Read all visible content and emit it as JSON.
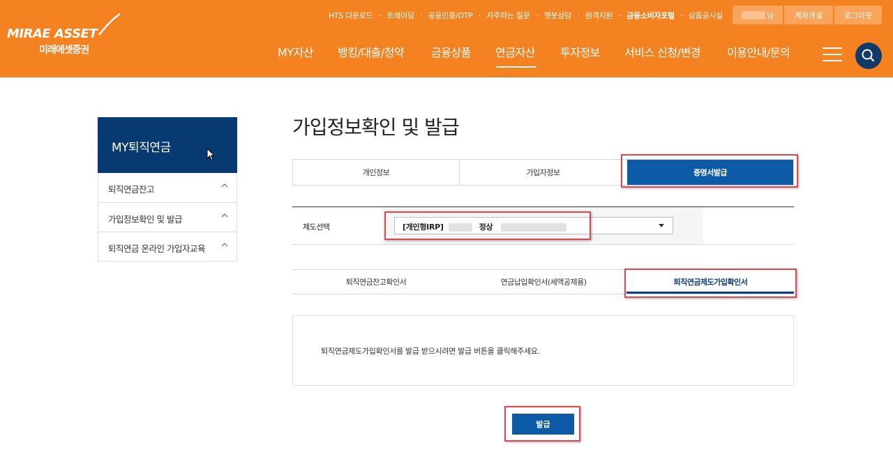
{
  "brand": {
    "name": "MIRAE ASSET",
    "name_ko": "미래에셋증권"
  },
  "utility_links": [
    "HTS 다운로드",
    "트레이딩",
    "공동인증/OTP",
    "자주하는 질문",
    "챗봇상담",
    "원격지원",
    "금융소비자포털",
    "상품공시실"
  ],
  "user": {
    "suffix": "님",
    "open_account": "계좌개설",
    "logout": "로그아웃"
  },
  "nav": {
    "items": [
      "MY자산",
      "뱅킹/대출/청약",
      "금융상품",
      "연금자산",
      "투자정보",
      "서비스 신청/변경",
      "이용안내/문의"
    ],
    "active": "연금자산"
  },
  "sidebar": {
    "title": "MY퇴직연금",
    "items": [
      {
        "label": "퇴직연금잔고"
      },
      {
        "label": "가입정보확인 및 발급"
      },
      {
        "label": "퇴직연금 온라인 가입자교육"
      }
    ]
  },
  "main": {
    "title": "가입정보확인 및 발급",
    "tabs": [
      {
        "label": "개인정보"
      },
      {
        "label": "가입자정보"
      },
      {
        "label": "증명서발급"
      }
    ],
    "select": {
      "label": "제도선택",
      "value_prefix": "[개인형IRP]",
      "value_status": "정상"
    },
    "doc_tabs": [
      {
        "label": "퇴직연금잔고확인서"
      },
      {
        "label": "연금납입확인서(세액공제용)"
      },
      {
        "label": "퇴직연금제도가입확인서"
      }
    ],
    "notice": "퇴직연금제도가입확인서를 발급 받으시려면 발급 버튼을 클릭해주세요.",
    "issue_button": "발급"
  },
  "colors": {
    "header": "#f58220",
    "primary": "#0d5aa7",
    "sidebar_header": "#073a70",
    "highlight": "#e0474f"
  }
}
